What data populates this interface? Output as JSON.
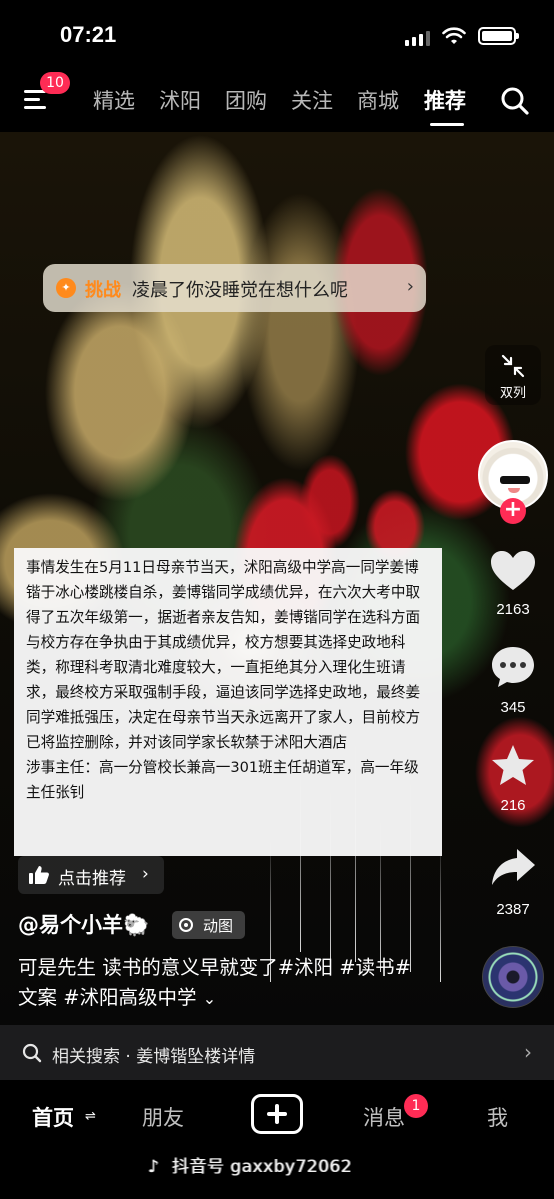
{
  "status_bar": {
    "time": "07:21"
  },
  "top_nav": {
    "badge": "10",
    "tabs": [
      {
        "label": "精选"
      },
      {
        "label": "沭阳"
      },
      {
        "label": "团购"
      },
      {
        "label": "关注"
      },
      {
        "label": "商城"
      },
      {
        "label": "推荐"
      }
    ],
    "active_tab": "推荐"
  },
  "challenge": {
    "tag": "挑战",
    "text": "凌晨了你没睡觉在想什么呢"
  },
  "dual_column_label": "双列",
  "rail": {
    "likes": "2163",
    "comments": "345",
    "favorites": "216",
    "shares": "2387"
  },
  "story": {
    "paragraph1": "事情发生在5月11日母亲节当天，沭阳高级中学高一同学姜博锴于冰心楼跳楼自杀，姜博锴同学成绩优异，在六次大考中取得了五次年级第一，据逝者亲友告知，姜博锴同学在选科方面与校方存在争执由于其成绩优异，校方想要其选择史政地科类，称理科考取清北难度较大，一直拒绝其分入理化生班请求，最终校方采取强制手段，逼迫该同学选择史政地，最终姜同学难抵强压，决定在母亲节当天永远离开了家人，目前校方已将监控删除，并对该同学家长软禁于沭阳大酒店",
    "paragraph2": "涉事主任：高一分管校长兼高一301班主任胡道军，高一年级主任张钊"
  },
  "recommend_label": "点击推荐",
  "author": {
    "name": "@易个小羊🐑",
    "tag": "动图"
  },
  "caption": {
    "text": "可是先生 读书的意义早就变了#沭阳 #读书#文案 #沭阳高级中学",
    "more": "⌄"
  },
  "related": {
    "label": "相关搜索 · 姜博锴坠楼详情"
  },
  "bottom_nav": {
    "home": "首页",
    "friends": "朋友",
    "messages": "消息",
    "messages_badge": "1",
    "me": "我"
  },
  "watermark": "抖音号 gaxxby72062",
  "colors": {
    "accent": "#fe2c55",
    "challenge": "#ff8a1c"
  }
}
